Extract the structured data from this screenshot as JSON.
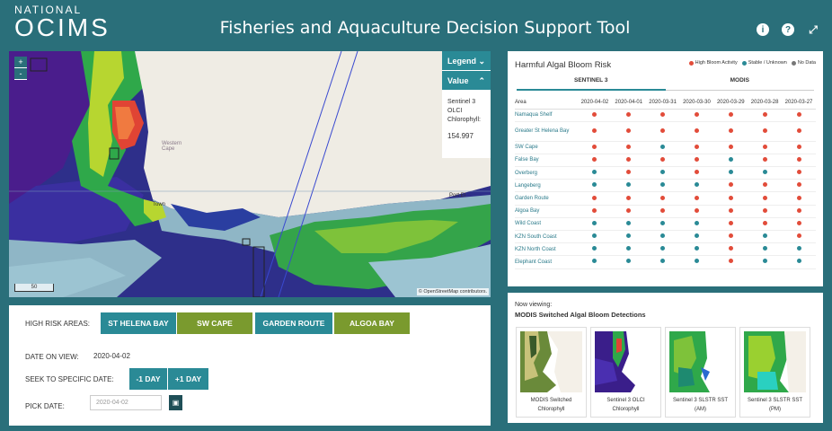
{
  "header": {
    "logo_line1": "NATIONAL",
    "logo_line2": "OCIMS",
    "title": "Fisheries and Aquaculture Decision Support Tool",
    "icons": [
      "info-icon",
      "help-icon",
      "fullscreen-icon"
    ]
  },
  "map": {
    "zoom_in": "+",
    "zoom_out": "-",
    "legend_label": "Legend",
    "value_label": "Value",
    "value_source": "Sentinel 3 OLCI Chlorophyll:",
    "value_number": "154.997",
    "region_label": "Western Cape",
    "place_label_1": "Port El",
    "place_label_2": "Town",
    "scale_label": "50 ",
    "attribution": "© OpenStreetMap contributors."
  },
  "controls": {
    "high_risk_label": "HIGH RISK AREAS:",
    "areas": [
      {
        "label": "ST HELENA BAY",
        "color": "#2a8a96"
      },
      {
        "label": "SW CAPE",
        "color": "#7a9a2e"
      },
      {
        "label": "GARDEN ROUTE",
        "color": "#2a8a96"
      },
      {
        "label": "ALGOA BAY",
        "color": "#7a9a2e"
      }
    ],
    "date_on_view_label": "DATE ON VIEW:",
    "date_on_view": "2020-04-02",
    "seek_label": "SEEK TO SPECIFIC DATE:",
    "minus_day": "-1 DAY",
    "plus_day": "+1 DAY",
    "pick_label": "PICK DATE:",
    "pick_placeholder": "2020-04-02",
    "calendar_icon": "calendar-icon"
  },
  "hab": {
    "title": "Harmful Algal Bloom Risk",
    "legend": [
      {
        "label": "High Bloom Activity",
        "color": "#e24c3a"
      },
      {
        "label": "Stable / Unknown",
        "color": "#2a8a96"
      },
      {
        "label": "No Data",
        "color": "#777777"
      }
    ],
    "tabs": [
      "SENTINEL 3",
      "MODIS"
    ],
    "area_header": "Area",
    "dates": [
      "2020-04-02",
      "2020-04-01",
      "2020-03-31",
      "2020-03-30",
      "2020-03-29",
      "2020-03-28",
      "2020-03-27"
    ],
    "rows": [
      {
        "area": "Namaqua Shelf",
        "status": [
          "r",
          "r",
          "r",
          "r",
          "r",
          "r",
          "r"
        ]
      },
      {
        "area": "Greater St Helena Bay",
        "status": [
          "r",
          "r",
          "r",
          "r",
          "r",
          "r",
          "r"
        ]
      },
      {
        "area": "SW Cape",
        "status": [
          "r",
          "r",
          "b",
          "r",
          "r",
          "r",
          "r"
        ]
      },
      {
        "area": "False Bay",
        "status": [
          "r",
          "r",
          "r",
          "r",
          "b",
          "r",
          "r"
        ]
      },
      {
        "area": "Overberg",
        "status": [
          "b",
          "r",
          "b",
          "r",
          "b",
          "b",
          "r"
        ]
      },
      {
        "area": "Langeberg",
        "status": [
          "b",
          "b",
          "b",
          "b",
          "r",
          "r",
          "r"
        ]
      },
      {
        "area": "Garden Route",
        "status": [
          "r",
          "r",
          "r",
          "r",
          "r",
          "r",
          "r"
        ]
      },
      {
        "area": "Algoa Bay",
        "status": [
          "r",
          "r",
          "r",
          "r",
          "r",
          "r",
          "r"
        ]
      },
      {
        "area": "Wild Coast",
        "status": [
          "b",
          "b",
          "b",
          "b",
          "r",
          "r",
          "r"
        ]
      },
      {
        "area": "KZN South Coast",
        "status": [
          "b",
          "b",
          "b",
          "b",
          "r",
          "b",
          "r"
        ]
      },
      {
        "area": "KZN North Coast",
        "status": [
          "b",
          "b",
          "b",
          "b",
          "r",
          "b",
          "b"
        ]
      },
      {
        "area": "Elephant Coast",
        "status": [
          "b",
          "b",
          "b",
          "b",
          "r",
          "b",
          "b"
        ]
      }
    ]
  },
  "now_viewing": {
    "label": "Now viewing:",
    "title": "MODIS Switched Algal Bloom Detections",
    "thumbs": [
      {
        "line1": "MODIS Switched",
        "line2": "Chlorophyll"
      },
      {
        "line1": "Sentinel 3 OLCI",
        "line2": "Chlorophyll"
      },
      {
        "line1": "Sentinel 3 SLSTR SST",
        "line2": "(AM)"
      },
      {
        "line1": "Sentinel 3 SLSTR SST",
        "line2": "(PM)"
      }
    ]
  }
}
